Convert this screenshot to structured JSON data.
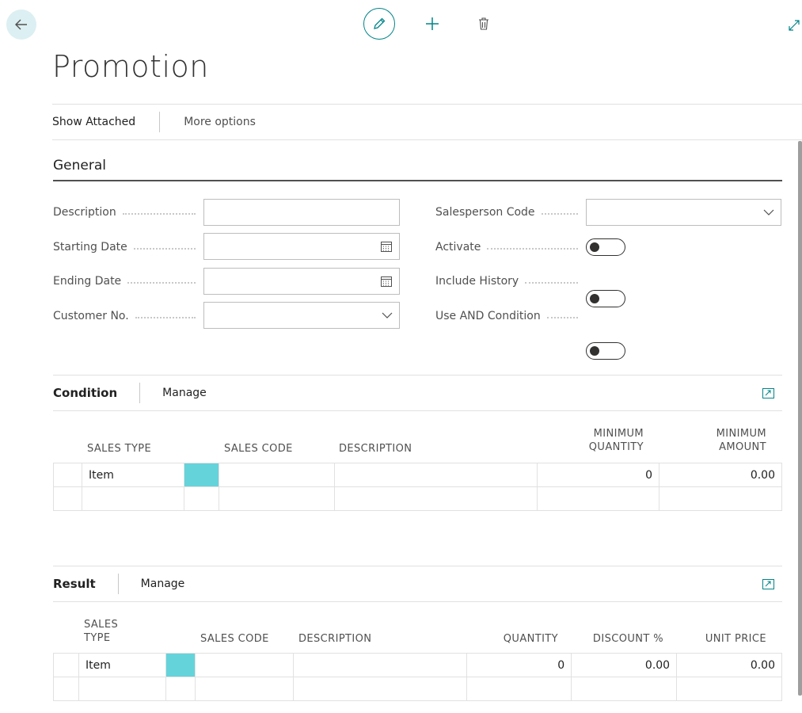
{
  "page": {
    "title": "Promotion"
  },
  "actions": {
    "show_attached": "Show Attached",
    "more_options": "More options"
  },
  "general": {
    "title": "General",
    "left_fields": [
      {
        "label": "Description",
        "value": "",
        "type": "text"
      },
      {
        "label": "Starting Date",
        "value": "",
        "type": "date"
      },
      {
        "label": "Ending Date",
        "value": "",
        "type": "date"
      },
      {
        "label": "Customer No.",
        "value": "",
        "type": "dropdown"
      }
    ],
    "right_fields": [
      {
        "label": "Salesperson Code",
        "value": "",
        "type": "dropdown"
      },
      {
        "label": "Activate",
        "value": "off",
        "type": "toggle"
      },
      {
        "label": "Include History",
        "value": "off",
        "type": "toggle"
      },
      {
        "label": "Use AND Condition",
        "value": "off",
        "type": "toggle"
      }
    ]
  },
  "condition": {
    "title": "Condition",
    "manage": "Manage",
    "columns": [
      "SALES TYPE",
      "SALES CODE",
      "DESCRIPTION",
      "MINIMUM QUANTITY",
      "MINIMUM AMOUNT"
    ],
    "col_head_lines": {
      "sales_type": "SALES TYPE",
      "sales_code": "SALES CODE",
      "description": "DESCRIPTION",
      "min_qty_1": "MINIMUM",
      "min_qty_2": "QUANTITY",
      "min_amt_1": "MINIMUM",
      "min_amt_2": "AMOUNT"
    },
    "rows": [
      {
        "sales_type": "Item",
        "sales_code": "",
        "description": "",
        "min_qty": "0",
        "min_amount": "0.00"
      },
      {
        "sales_type": "",
        "sales_code": "",
        "description": "",
        "min_qty": "",
        "min_amount": ""
      }
    ]
  },
  "result": {
    "title": "Result",
    "manage": "Manage",
    "columns": [
      "SALES TYPE",
      "SALES CODE",
      "DESCRIPTION",
      "QUANTITY",
      "DISCOUNT %",
      "UNIT PRICE"
    ],
    "col_head_lines": {
      "sales_type_1": "SALES",
      "sales_type_2": "TYPE",
      "sales_code": "SALES CODE",
      "description": "DESCRIPTION",
      "quantity": "QUANTITY",
      "discount": "DISCOUNT %",
      "unit_price": "UNIT PRICE"
    },
    "rows": [
      {
        "sales_type": "Item",
        "sales_code": "",
        "description": "",
        "quantity": "0",
        "discount": "0.00",
        "unit_price": "0.00"
      },
      {
        "sales_type": "",
        "sales_code": "",
        "description": "",
        "quantity": "",
        "discount": "",
        "unit_price": ""
      }
    ]
  },
  "colors": {
    "accent": "#008489",
    "selected_cell": "#65d3da",
    "back_button_bg": "#dceff2"
  },
  "icons": [
    "back-arrow-icon",
    "edit-pencil-icon",
    "plus-icon",
    "trash-icon",
    "expand-icon",
    "calendar-icon",
    "chevron-down-icon",
    "open-in-new-icon"
  ]
}
